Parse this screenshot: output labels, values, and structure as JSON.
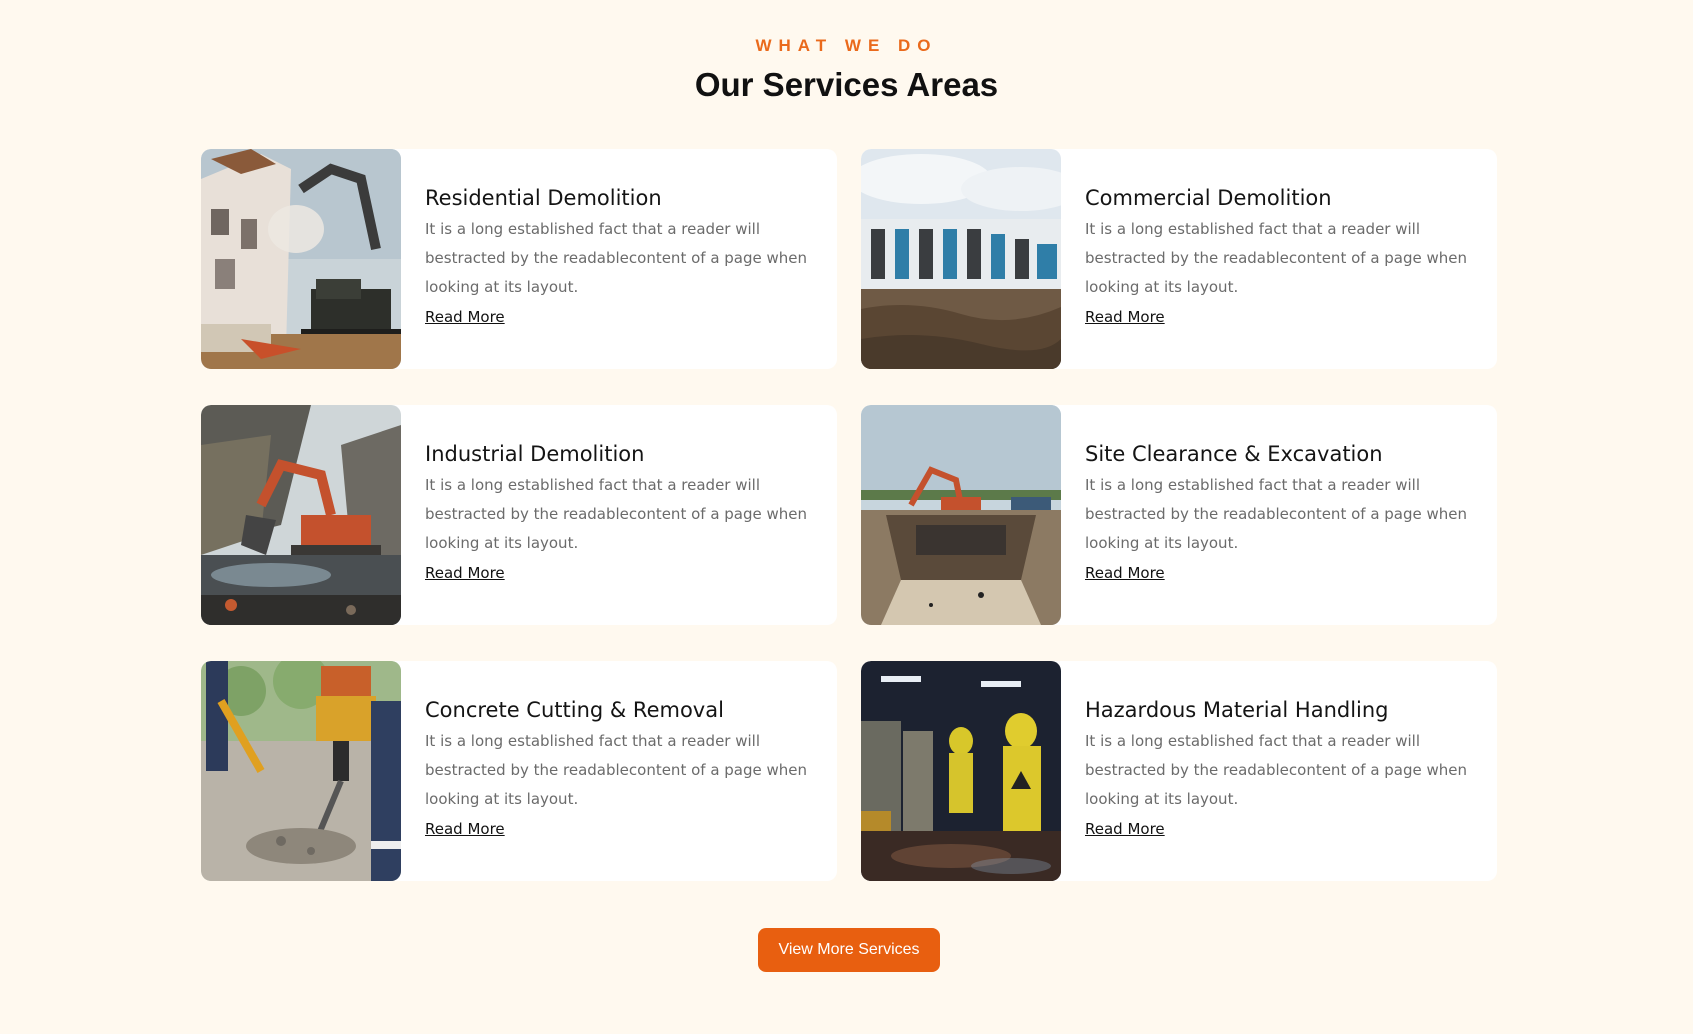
{
  "section": {
    "eyebrow": "WHAT WE DO",
    "title": "Our Services Areas"
  },
  "services": [
    {
      "title": "Residential Demolition",
      "description": "It is a long established fact that a reader will bestracted by the readablecontent of a page when looking at its layout.",
      "link": "Read More"
    },
    {
      "title": "Commercial Demolition",
      "description": "It is a long established fact that a reader will bestracted by the readablecontent of a page when looking at its layout.",
      "link": "Read More"
    },
    {
      "title": "Industrial Demolition",
      "description": "It is a long established fact that a reader will bestracted by the readablecontent of a page when looking at its layout.",
      "link": "Read More"
    },
    {
      "title": "Site Clearance & Excavation",
      "description": "It is a long established fact that a reader will bestracted by the readablecontent of a page when looking at its layout.",
      "link": "Read More"
    },
    {
      "title": "Concrete Cutting & Removal",
      "description": "It is a long established fact that a reader will bestracted by the readablecontent of a page when looking at its layout.",
      "link": "Read More"
    },
    {
      "title": "Hazardous Material Handling",
      "description": "It is a long established fact that a reader will bestracted by the readablecontent of a page when looking at its layout.",
      "link": "Read More"
    }
  ],
  "cta": {
    "label": "View More Services"
  },
  "colors": {
    "background": "#fff9ef",
    "accent": "#ea6a1c",
    "button": "#e85f10"
  }
}
